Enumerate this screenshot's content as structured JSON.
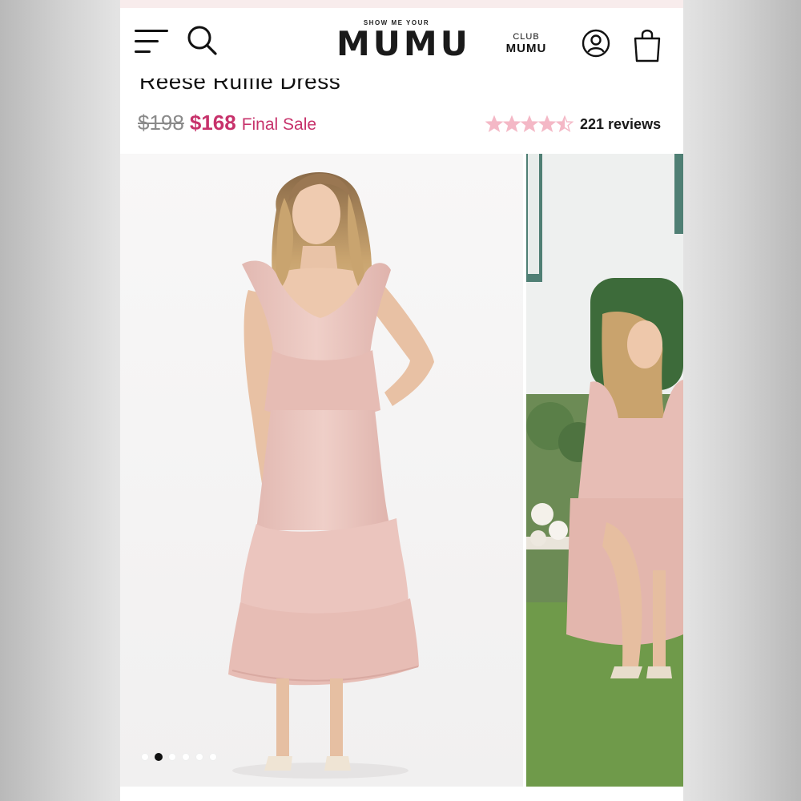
{
  "header": {
    "logo_small": "SHOW ME YOUR",
    "logo_big": "MUMU",
    "club_top": "CLUB",
    "club_bottom": "MUMU"
  },
  "product": {
    "title": "Reese Ruffle Dress",
    "old_price": "$198",
    "new_price": "$168",
    "sale_label": "Final Sale",
    "rating": 4.5,
    "reviews_label": "221 reviews"
  },
  "gallery": {
    "dot_count": 6,
    "active_dot_index": 1
  },
  "colors": {
    "accent_pink": "#c7326b",
    "star_pink": "#f4b8c6",
    "dress_blush": "#e9c2bb"
  }
}
